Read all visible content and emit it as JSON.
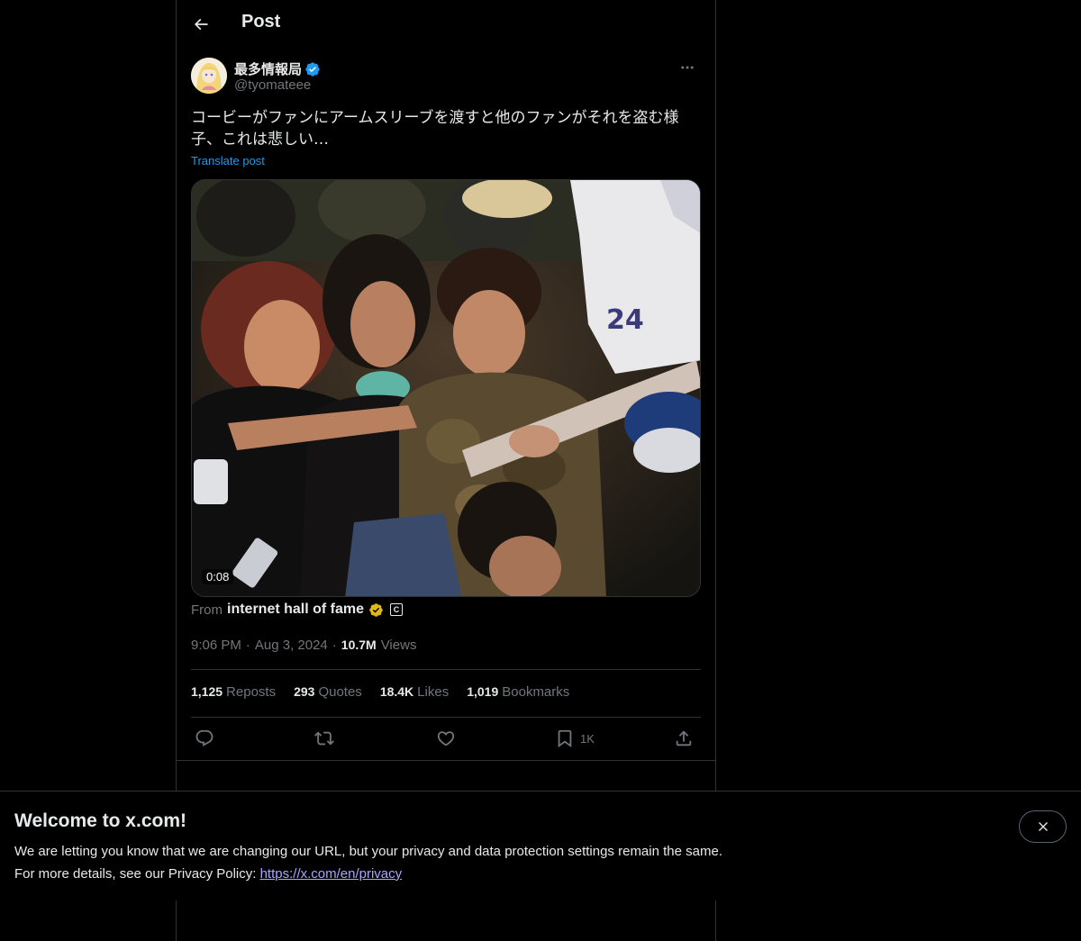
{
  "header": {
    "title": "Post"
  },
  "author": {
    "display_name": "最多情報局",
    "handle": "@tyomateee"
  },
  "post": {
    "text": "コービーがファンにアームスリーブを渡すと他のファンがそれを盗む様子、これは悲しい…",
    "translate_label": "Translate post",
    "video_duration": "0:08",
    "from_label": "From",
    "from_account": "internet hall of fame",
    "from_badge": "C",
    "time": "9:06 PM",
    "date": "Aug 3, 2024",
    "views_count": "10.7M",
    "views_label": "Views",
    "separator": "·"
  },
  "stats": [
    {
      "num": "1,125",
      "label": "Reposts"
    },
    {
      "num": "293",
      "label": "Quotes"
    },
    {
      "num": "18.4K",
      "label": "Likes"
    },
    {
      "num": "1,019",
      "label": "Bookmarks"
    }
  ],
  "actions": {
    "bookmark_count": "1K"
  },
  "banner": {
    "title": "Welcome to x.com!",
    "line1": "We are letting you know that we are changing our URL, but your privacy and data protection settings remain the same.",
    "line2_prefix": "For more details, see our Privacy Policy: ",
    "link": "https://x.com/en/privacy"
  },
  "colors": {
    "background": "#000000",
    "text": "#e7e9ea",
    "muted": "#71767b",
    "accent": "#1d9bf0",
    "link_banner": "#a8a7ff",
    "verified_blue": "#1d9bf0",
    "verified_gold": "#e2b719"
  },
  "icons": [
    "back-arrow-icon",
    "verified-badge-icon",
    "more-icon",
    "gold-verified-icon",
    "reply-icon",
    "repost-icon",
    "like-icon",
    "bookmark-icon",
    "share-icon",
    "close-icon"
  ]
}
